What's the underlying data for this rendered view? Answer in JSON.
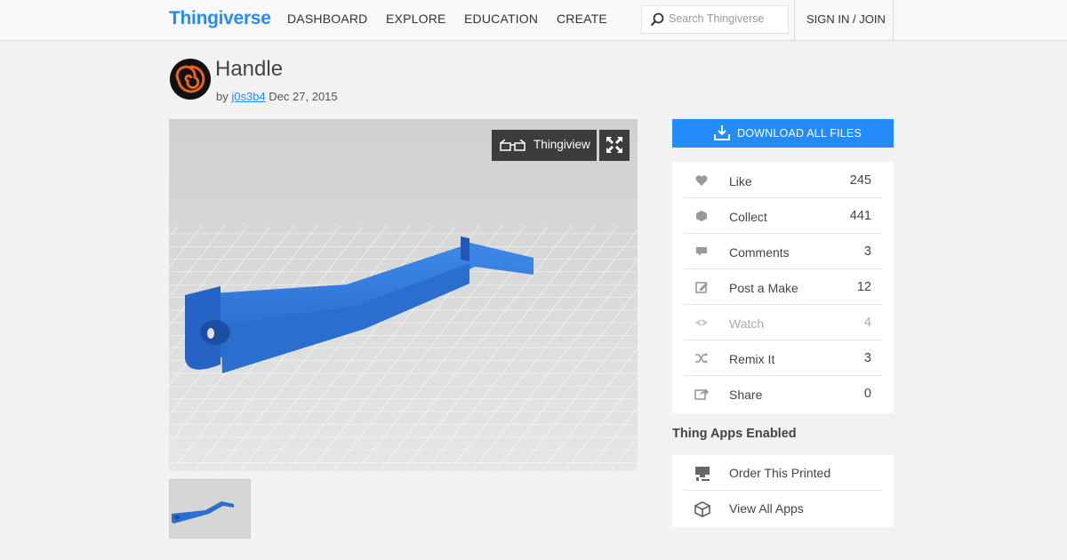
{
  "header": {
    "logo": "Thingiverse",
    "nav": [
      "DASHBOARD",
      "EXPLORE",
      "EDUCATION",
      "CREATE"
    ],
    "search_placeholder": "Search Thingiverse",
    "signin": "SIGN IN / JOIN"
  },
  "thing": {
    "title": "Handle",
    "by_prefix": "by",
    "author": "j0s3b4",
    "date": "Dec 27, 2015"
  },
  "viewer": {
    "thingiview_label": "Thingiview"
  },
  "actions": {
    "download_label": "DOWNLOAD ALL FILES",
    "stats": [
      {
        "label": "Like",
        "count": "245",
        "icon": "heart-icon"
      },
      {
        "label": "Collect",
        "count": "441",
        "icon": "collect-icon"
      },
      {
        "label": "Comments",
        "count": "3",
        "icon": "comment-icon"
      },
      {
        "label": "Post a Make",
        "count": "12",
        "icon": "post-make-icon"
      },
      {
        "label": "Watch",
        "count": "4",
        "icon": "eye-icon"
      },
      {
        "label": "Remix It",
        "count": "3",
        "icon": "remix-icon"
      },
      {
        "label": "Share",
        "count": "0",
        "icon": "share-icon"
      }
    ]
  },
  "apps": {
    "heading": "Thing Apps Enabled",
    "items": [
      {
        "label": "Order This Printed",
        "icon": "printer-icon"
      },
      {
        "label": "View All Apps",
        "icon": "cube-icon"
      }
    ]
  },
  "colors": {
    "accent": "#248bfb",
    "model": "#2a6fce",
    "dark_button": "#3c3c3c"
  }
}
